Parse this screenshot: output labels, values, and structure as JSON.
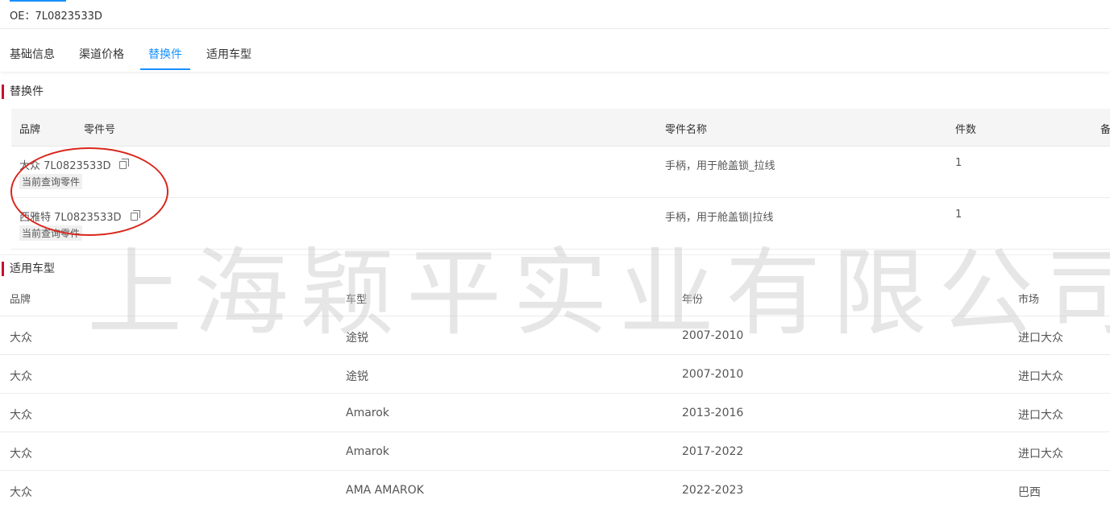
{
  "oe": {
    "label": "OE：7L0823533D"
  },
  "tabs": [
    {
      "label": "基础信息"
    },
    {
      "label": "渠道价格"
    },
    {
      "label": "替换件"
    },
    {
      "label": "适用车型"
    }
  ],
  "replacement": {
    "title": "替换件",
    "headers": {
      "brand": "品牌",
      "part_no": "零件号",
      "part_name": "零件名称",
      "qty": "件数",
      "note": "备"
    },
    "rows": [
      {
        "brand_part": "大众 7L0823533D",
        "name": "手柄，用于舱盖锁_拉线",
        "qty": "1",
        "tag": "当前查询零件"
      },
      {
        "brand_part": "西雅特 7L0823533D",
        "name": "手柄，用于舱盖锁|拉线",
        "qty": "1",
        "tag": "当前查询零件"
      }
    ]
  },
  "vehicles": {
    "title": "适用车型",
    "headers": {
      "brand": "品牌",
      "model": "车型",
      "year": "年份",
      "market": "市场"
    },
    "rows": [
      {
        "brand": "大众",
        "model": "途锐",
        "year": "2007-2010",
        "market": "进口大众"
      },
      {
        "brand": "大众",
        "model": "途锐",
        "year": "2007-2010",
        "market": "进口大众"
      },
      {
        "brand": "大众",
        "model": "Amarok",
        "year": "2013-2016",
        "market": "进口大众"
      },
      {
        "brand": "大众",
        "model": "Amarok",
        "year": "2017-2022",
        "market": "进口大众"
      },
      {
        "brand": "大众",
        "model": "AMA AMAROK",
        "year": "2022-2023",
        "market": "巴西"
      }
    ]
  },
  "watermark": "上海颖平实业有限公司",
  "colors": {
    "accent": "#1890ff",
    "section_marker": "#c8102e",
    "annotation": "#d9261c"
  }
}
